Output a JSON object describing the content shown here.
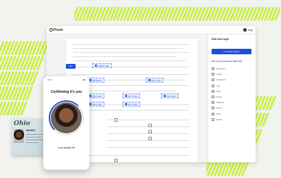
{
  "app": {
    "brand": "Proof.",
    "help_label": "Help"
  },
  "document": {
    "sign_tag": "Sign",
    "today_date": "Today's date",
    "full_name": "Full Name",
    "fill_in_here": "Fill in here"
  },
  "sidebar": {
    "title": "Edit and sign",
    "primary_button": "Complete signing",
    "section_label": "Fill out your document (optional)",
    "items": [
      {
        "label": "Signature",
        "icon": "signature-icon"
      },
      {
        "label": "Initials",
        "icon": "initials-icon"
      },
      {
        "label": "Checkbox",
        "icon": "checkbox-icon"
      },
      {
        "label": "Text",
        "icon": "text-icon"
      },
      {
        "label": "Date",
        "icon": "date-icon"
      },
      {
        "label": "Name",
        "icon": "name-icon"
      },
      {
        "label": "Address",
        "icon": "address-icon"
      },
      {
        "label": "Phone",
        "icon": "phone-icon"
      },
      {
        "label": "SSN",
        "icon": "ssn-icon"
      },
      {
        "label": "Email",
        "icon": "email-icon"
      }
    ]
  },
  "phone": {
    "time": "4:12",
    "title": "Confirming it's you",
    "instruction": "Look slightly left"
  },
  "id_card": {
    "state": "Ohio",
    "name": "MRGEN"
  },
  "colors": {
    "accent": "#1d4fd6",
    "stripe": "#c8f03c"
  }
}
